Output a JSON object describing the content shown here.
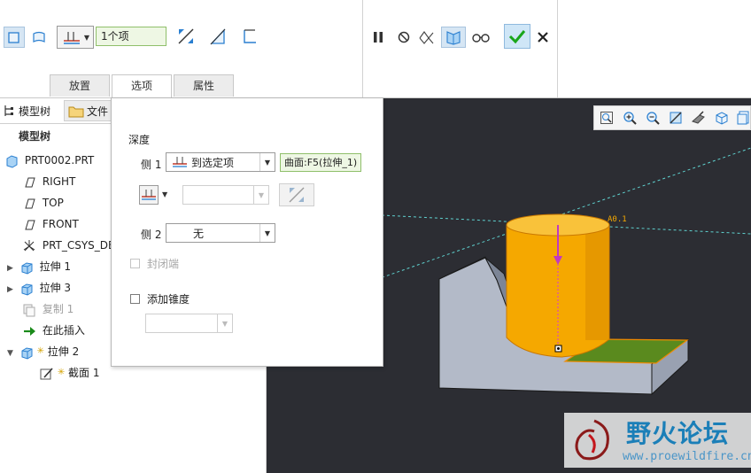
{
  "ribbon": {
    "depth_value": "1个项",
    "tabs": [
      "放置",
      "选项",
      "属性"
    ],
    "active_tab": "选项"
  },
  "left_panel": {
    "tab_model_tree": "模型树",
    "tab_file": "文件",
    "tree_header": "模型树",
    "items": [
      {
        "label": "PRT0002.PRT",
        "icon": "part-icon"
      },
      {
        "label": "RIGHT",
        "icon": "datum-plane-icon"
      },
      {
        "label": "TOP",
        "icon": "datum-plane-icon"
      },
      {
        "label": "FRONT",
        "icon": "datum-plane-icon"
      },
      {
        "label": "PRT_CSYS_DEF",
        "icon": "csys-icon"
      },
      {
        "label": "拉伸 1",
        "icon": "extrude-icon"
      },
      {
        "label": "拉伸 3",
        "icon": "extrude-icon"
      },
      {
        "label": "复制 1",
        "icon": "copy-icon"
      },
      {
        "label": "在此插入",
        "icon": "insert-here-arrow-icon"
      },
      {
        "label": "拉伸 2",
        "icon": "extrude-icon"
      },
      {
        "label": "截面 1",
        "icon": "sketch-icon"
      }
    ]
  },
  "options_panel": {
    "depth_title": "深度",
    "side1_label": "侧 1",
    "side1_value": "到选定项",
    "side1_reference": "曲面:F5(拉伸_1)",
    "side2_label": "侧 2",
    "side2_value": "无",
    "capped_ends_label": "封闭端",
    "add_taper_label": "添加锥度"
  },
  "viewport": {
    "dimension_label": "A0.1"
  },
  "watermark": {
    "title": "野火论坛",
    "url": "www.proewildfire.cn"
  },
  "colors": {
    "accent_blue": "#2a7fd0",
    "preview_orange": "#f5a800",
    "surface_green": "#5a8a1e",
    "confirm_green": "#1aa61a",
    "viewport_bg": "#2c2d33"
  }
}
